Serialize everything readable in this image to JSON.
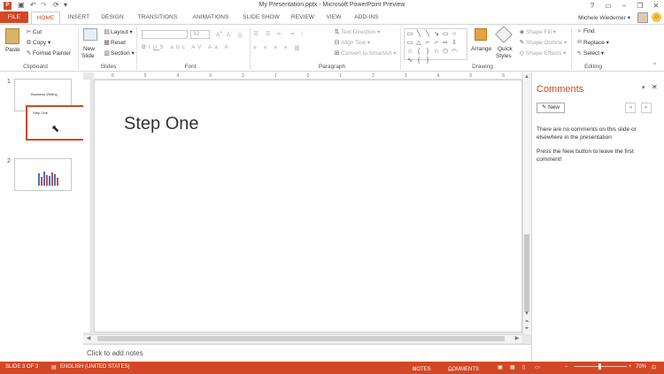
{
  "window": {
    "title": "My Presentation.pptx - Microsoft PowerPoint Preview",
    "app_badge": "P",
    "qat": [
      "save-icon",
      "undo-icon",
      "redo-icon",
      "customize-icon"
    ],
    "controls": [
      "?",
      "▭",
      "–",
      "❐",
      "✕"
    ]
  },
  "tabs": [
    "FILE",
    "HOME",
    "INSERT",
    "DESIGN",
    "TRANSITIONS",
    "ANIMATIONS",
    "SLIDE SHOW",
    "REVIEW",
    "VIEW",
    "ADD-INS"
  ],
  "user": {
    "name": "Michele Wiedemer ▾",
    "smiley": "☺"
  },
  "ribbon": {
    "clipboard": {
      "label": "Clipboard",
      "paste": "Paste",
      "cut": "Cut",
      "copy": "Copy",
      "format_painter": "Format Painter"
    },
    "slides": {
      "label": "Slides",
      "new_slide": "New",
      "new_slide2": "Slide",
      "layout": "Layout",
      "reset": "Reset",
      "section": "Section"
    },
    "font": {
      "label": "Font",
      "size": "32"
    },
    "paragraph": {
      "label": "Paragraph",
      "text_direction": "Text Direction",
      "align_text": "Align Text",
      "convert": "Convert to SmartArt"
    },
    "drawing": {
      "label": "Drawing",
      "arrange": "Arrange",
      "quick_styles": "Quick",
      "quick_styles2": "Styles",
      "shape_fill": "Shape Fill",
      "shape_outline": "Shape Outline",
      "shape_effects": "Shape Effects"
    },
    "editing": {
      "label": "Editing",
      "find": "Find",
      "replace": "Replace",
      "select": "Select"
    }
  },
  "slides_pane": {
    "items": [
      {
        "num": "1",
        "thumb_text": "Business Writing"
      },
      {
        "num": "2"
      }
    ],
    "dragging_text": "Step One"
  },
  "slide": {
    "title": "Step One"
  },
  "ruler_numbers": [
    "6",
    "5",
    "4",
    "3",
    "2",
    "1",
    "0",
    "1",
    "2",
    "3",
    "4",
    "5",
    "6"
  ],
  "notes": {
    "placeholder": "Click to add notes"
  },
  "comments": {
    "title": "Comments",
    "new_button": "New",
    "message1": "There are no comments on this slide or elsewhere in the presentation",
    "message2": "Press the New button to leave the first comment!"
  },
  "status": {
    "slide": "SLIDE 3 OF 3",
    "language": "ENGLISH (UNITED STATES)",
    "notes": "NOTES",
    "comments": "COMMENTS",
    "zoom": "70%"
  },
  "colors": {
    "accent": "#d24726",
    "workspace": "#e7e7e7"
  }
}
